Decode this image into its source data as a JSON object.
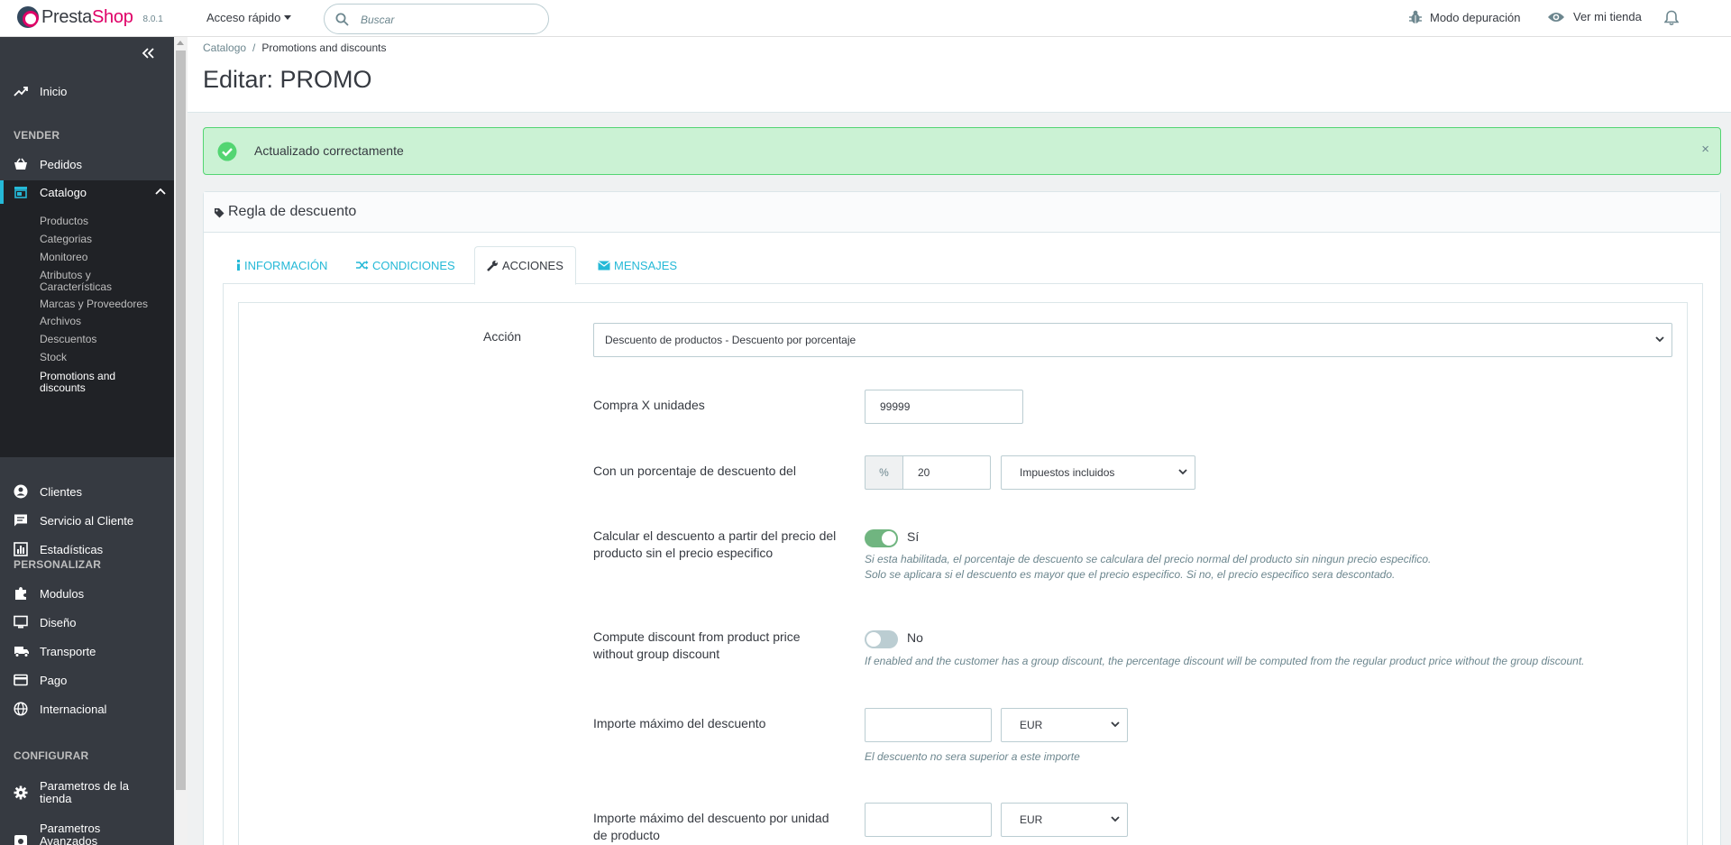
{
  "header": {
    "logo_part1": "Presta",
    "logo_part2": "Shop",
    "version": "8.0.1",
    "quick_access": "Acceso rápido",
    "search_placeholder": "Buscar",
    "debug_mode": "Modo depuración",
    "view_shop": "Ver mi tienda"
  },
  "sidebar": {
    "home": "Inicio",
    "sections": {
      "sell": "VENDER",
      "customize": "PERSONALIZAR",
      "configure": "CONFIGURAR"
    },
    "sell_items": [
      "Pedidos",
      "Catalogo"
    ],
    "catalog_sub": [
      "Productos",
      "Categorias",
      "Monitoreo",
      "Atributos y Características",
      "Marcas y Proveedores",
      "Archivos",
      "Descuentos",
      "Stock",
      "Promotions and discounts"
    ],
    "sell_items2": [
      "Clientes",
      "Servicio al Cliente",
      "Estadísticas"
    ],
    "customize_items": [
      "Modulos",
      "Diseño",
      "Transporte",
      "Pago",
      "Internacional"
    ],
    "configure_items": [
      "Parametros de la tienda",
      "Parametros Avanzados"
    ]
  },
  "page": {
    "breadcrumb": [
      "Catalogo",
      "Promotions and discounts"
    ],
    "breadcrumb_sep": "/",
    "title": "Editar: PROMO"
  },
  "alert": {
    "message": "Actualizado correctamente",
    "close": "×"
  },
  "panel": {
    "title": "Regla de descuento",
    "tabs": [
      "INFORMACIÓN",
      "CONDICIONES",
      "ACCIONES",
      "MENSAJES"
    ],
    "active_tab": "ACCIONES"
  },
  "form": {
    "action_label": "Acción",
    "action_value": "Descuento de productos - Descuento por porcentaje",
    "buy_x_label": "Compra X unidades",
    "buy_x_value": "99999",
    "percent_label": "Con un porcentaje de descuento del",
    "percent_addon": "%",
    "percent_value": "20",
    "tax_value": "Impuestos incluidos",
    "calc_label": "Calcular el descuento a partir del precio del producto sin el precio especifico",
    "calc_state": "Sí",
    "calc_on": true,
    "calc_help1": "Si esta habilitada, el porcentaje de descuento se calculara del precio normal del producto sin ningun precio especifico.",
    "calc_help2": "Solo se aplicara si el descuento es mayor que el precio especifico. Si no, el precio especifico sera descontado.",
    "group_label": "Compute discount from product price without group discount",
    "group_state": "No",
    "group_on": false,
    "group_help": "If enabled and the customer has a group discount, the percentage discount will be computed from the regular product price without the group discount.",
    "max_label": "Importe máximo del descuento",
    "max_value": "",
    "max_currency": "EUR",
    "max_help": "El descuento no sera superior a este importe",
    "max_unit_label": "Importe máximo del descuento por unidad de producto",
    "max_unit_value": "",
    "max_unit_currency": "EUR"
  },
  "colors": {
    "sidebar_bg": "#363a41",
    "accent": "#25b9d7",
    "success_bg": "#cbf2d4",
    "success_border": "#53d572",
    "brand_pink": "#df0067",
    "switch_on": "#70b580"
  }
}
